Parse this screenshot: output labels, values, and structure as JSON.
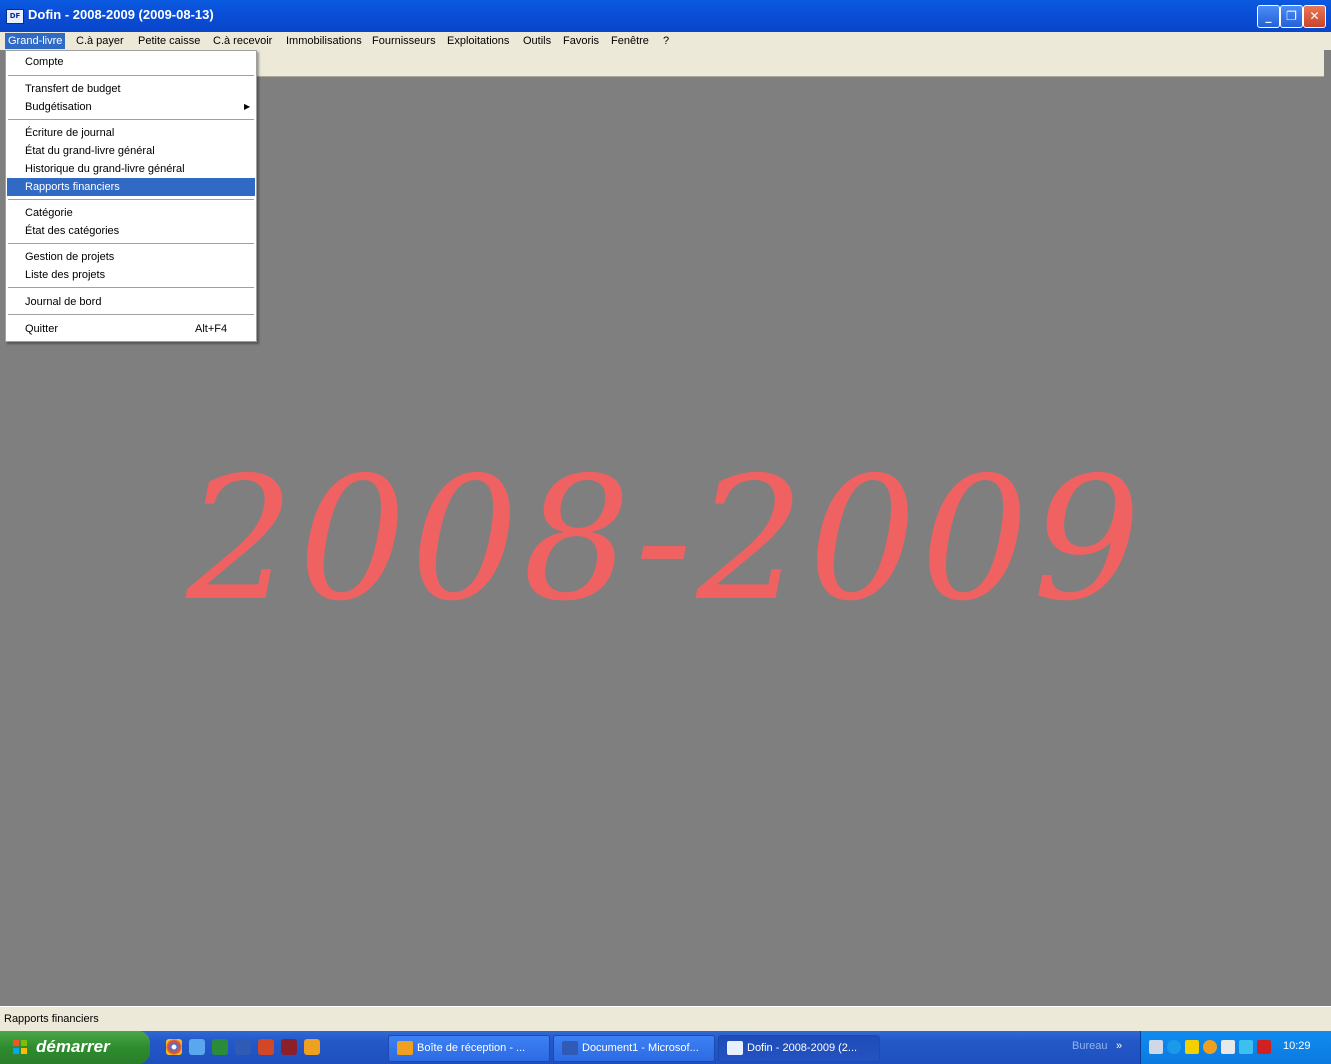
{
  "window": {
    "title": "Dofin - 2008-2009 (2009-08-13)",
    "app_icon": "dofin-icon",
    "buttons": {
      "minimize": "_",
      "restore": "❐",
      "close": "✕"
    }
  },
  "menubar": {
    "items": [
      "Grand-livre",
      "C.à payer",
      "Petite caisse",
      "C.à recevoir",
      "Immobilisations",
      "Fournisseurs",
      "Exploitations",
      "Outils",
      "Favoris",
      "Fenêtre",
      "?"
    ],
    "active": "Grand-livre"
  },
  "dropdown": {
    "items": [
      {
        "label": "Compte"
      },
      {
        "label": "Transfert de budget"
      },
      {
        "label": "Budgétisation",
        "submenu": true
      },
      {
        "label": "Écriture de journal"
      },
      {
        "label": "État du grand-livre général"
      },
      {
        "label": "Historique du grand-livre général"
      },
      {
        "label": "Rapports financiers",
        "highlighted": true
      },
      {
        "label": "Catégorie"
      },
      {
        "label": "État des catégories"
      },
      {
        "label": "Gestion de projets"
      },
      {
        "label": "Liste des projets"
      },
      {
        "label": "Journal de bord"
      },
      {
        "label": "Quitter",
        "shortcut": "Alt+F4"
      }
    ],
    "submenu_arrow": "▶"
  },
  "watermark": "2008-2009",
  "statusbar": {
    "text": "Rapports financiers"
  },
  "taskbar": {
    "start_label": "démarrer",
    "quick_launch": [
      "chrome-icon",
      "ie-icon",
      "excel-icon",
      "word-icon",
      "powerpoint-icon",
      "access-icon",
      "outlook-icon"
    ],
    "tasks": [
      {
        "label": "Boîte de réception - ...",
        "icon": "outlook-icon"
      },
      {
        "label": "Document1 - Microsof...",
        "icon": "word-icon"
      },
      {
        "label": "Dofin - 2008-2009 (2...",
        "icon": "dofin-icon",
        "active": true
      }
    ],
    "bureau_label": "Bureau",
    "chevron": "»",
    "clock": "10:29"
  },
  "colors": {
    "accent": "#316ac5",
    "watermark": "#f06262",
    "workspace": "#7f7f7f",
    "menubar": "#ece9d8"
  }
}
